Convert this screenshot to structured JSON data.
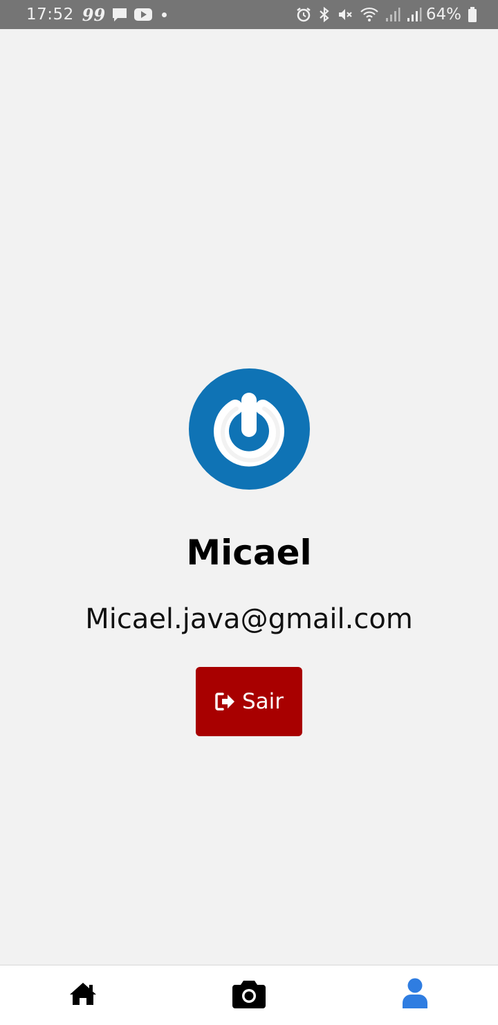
{
  "status_bar": {
    "time": "17:52",
    "quote_glyph": "99",
    "battery_percent": "64%",
    "icons": [
      "message-icon",
      "youtube-icon",
      "notification-dot",
      "alarm-icon",
      "bluetooth-icon",
      "mute-icon",
      "wifi-icon",
      "signal-icon",
      "signal-icon",
      "battery-icon"
    ]
  },
  "profile": {
    "avatar_icon": "power-icon",
    "name": "Micael",
    "email": "Micael.java@gmail.com"
  },
  "logout": {
    "label": "Sair",
    "icon": "sign-out-icon",
    "color": "#a80000"
  },
  "bottom_nav": {
    "items": [
      {
        "icon": "home-icon",
        "active": false
      },
      {
        "icon": "camera-icon",
        "active": false
      },
      {
        "icon": "user-icon",
        "active": true
      }
    ],
    "active_color": "#2f7de1"
  }
}
